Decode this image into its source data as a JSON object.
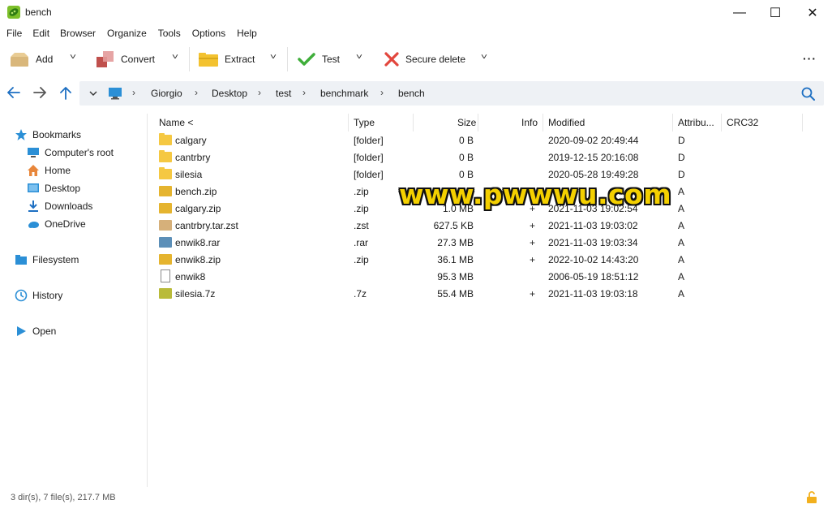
{
  "window": {
    "title": "bench",
    "minimize_glyph": "—",
    "maximize_glyph": "☐",
    "close_glyph": "✕"
  },
  "menu": [
    "File",
    "Edit",
    "Browser",
    "Organize",
    "Tools",
    "Options",
    "Help"
  ],
  "toolbar": {
    "add": "Add",
    "convert": "Convert",
    "extract": "Extract",
    "test": "Test",
    "secure_delete": "Secure delete",
    "more": "···",
    "dropdown_glyph": "˅"
  },
  "address": {
    "crumbs": [
      "Giorgio",
      "Desktop",
      "test",
      "benchmark",
      "bench"
    ]
  },
  "sidebar": {
    "items": [
      {
        "label": "Bookmarks",
        "icon": "star-icon"
      },
      {
        "label": "Computer's root",
        "icon": "computer-icon"
      },
      {
        "label": "Home",
        "icon": "home-icon"
      },
      {
        "label": "Desktop",
        "icon": "desktop-icon"
      },
      {
        "label": "Downloads",
        "icon": "download-icon"
      },
      {
        "label": "OneDrive",
        "icon": "cloud-icon"
      },
      {
        "label": "Filesystem",
        "icon": "folder-icon"
      },
      {
        "label": "History",
        "icon": "history-icon"
      },
      {
        "label": "Open",
        "icon": "play-icon"
      }
    ]
  },
  "columns": [
    "Name <",
    "Type",
    "Size",
    "Info",
    "Modified",
    "Attribu...",
    "CRC32"
  ],
  "files": [
    {
      "name": "calgary",
      "type": "[folder]",
      "size": "0 B",
      "info": "",
      "modified": "2020-09-02 20:49:44",
      "attr": "D",
      "kind": "folder"
    },
    {
      "name": "cantrbry",
      "type": "[folder]",
      "size": "0 B",
      "info": "",
      "modified": "2019-12-15 20:16:08",
      "attr": "D",
      "kind": "folder"
    },
    {
      "name": "silesia",
      "type": "[folder]",
      "size": "0 B",
      "info": "",
      "modified": "2020-05-28 19:49:28",
      "attr": "D",
      "kind": "folder"
    },
    {
      "name": "bench.zip",
      "type": ".zip",
      "size": "",
      "info": "",
      "modified": "",
      "attr": "A",
      "kind": "zip"
    },
    {
      "name": "calgary.zip",
      "type": ".zip",
      "size": "1.0 MB",
      "info": "+",
      "modified": "2021-11-03 19:02:54",
      "attr": "A",
      "kind": "zip"
    },
    {
      "name": "cantrbry.tar.zst",
      "type": ".zst",
      "size": "627.5 KB",
      "info": "+",
      "modified": "2021-11-03 19:03:02",
      "attr": "A",
      "kind": "zst"
    },
    {
      "name": "enwik8.rar",
      "type": ".rar",
      "size": "27.3 MB",
      "info": "+",
      "modified": "2021-11-03 19:03:34",
      "attr": "A",
      "kind": "rar"
    },
    {
      "name": "enwik8.zip",
      "type": ".zip",
      "size": "36.1 MB",
      "info": "+",
      "modified": "2022-10-02 14:43:20",
      "attr": "A",
      "kind": "zip"
    },
    {
      "name": "enwik8",
      "type": "",
      "size": "95.3 MB",
      "info": "",
      "modified": "2006-05-19 18:51:12",
      "attr": "A",
      "kind": "file"
    },
    {
      "name": "silesia.7z",
      "type": ".7z",
      "size": "55.4 MB",
      "info": "+",
      "modified": "2021-11-03 19:03:18",
      "attr": "A",
      "kind": "7z"
    }
  ],
  "watermark": "www.pwwwu.com",
  "status": "3 dir(s), 7 file(s), 217.7 MB"
}
